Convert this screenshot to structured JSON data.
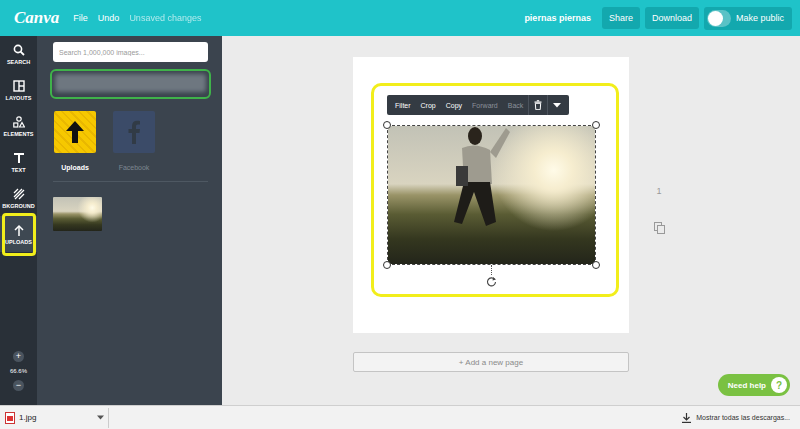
{
  "topbar": {
    "logo": "Canva",
    "menu": [
      "File",
      "Undo"
    ],
    "save_status": "Unsaved changes",
    "design_title": "piernas piernas",
    "buttons": [
      "Share",
      "Download"
    ],
    "public_toggle": {
      "label": "Make public",
      "on": false
    }
  },
  "sidebar": {
    "items": [
      {
        "label": "SEARCH",
        "selected": false
      },
      {
        "label": "LAYOUTS",
        "selected": false
      },
      {
        "label": "ELEMENTS",
        "selected": false
      },
      {
        "label": "TEXT",
        "selected": false
      },
      {
        "label": "BKGROUND",
        "selected": false
      },
      {
        "label": "UPLOADS",
        "selected": true
      }
    ],
    "zoom": {
      "in": "+",
      "level": "66.6%",
      "out": "−"
    }
  },
  "panel": {
    "search": {
      "placeholder": "Search 1,000,000 images..."
    },
    "sources": [
      {
        "label": "Uploads",
        "selected": true
      },
      {
        "label": "Facebook",
        "selected": false
      }
    ]
  },
  "element_toolbar": [
    {
      "label": "Filter",
      "disabled": false
    },
    {
      "label": "Crop",
      "disabled": false
    },
    {
      "label": "Copy",
      "disabled": false
    },
    {
      "label": "Forward",
      "disabled": true
    },
    {
      "label": "Back",
      "disabled": true
    }
  ],
  "page": {
    "number": "1",
    "image_selected": true
  },
  "add_page": "+ Add a new page",
  "help": {
    "label": "Need help",
    "icon": "?"
  },
  "downloads": {
    "file": "1.jpg",
    "show_all": "Mostrar todas las descargas..."
  }
}
